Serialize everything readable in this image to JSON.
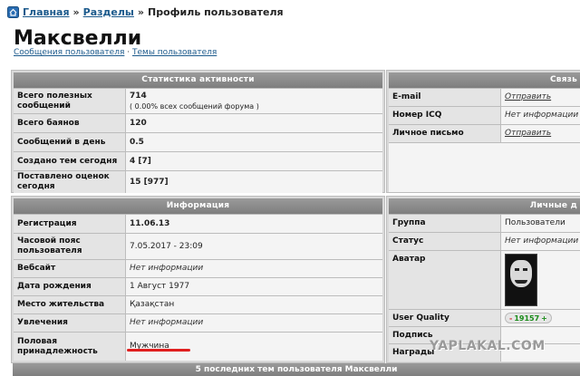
{
  "breadcrumb": {
    "home": "Главная",
    "sections": "Разделы",
    "sep": "»",
    "current": "Профиль пользователя"
  },
  "page_title": "Максвелли",
  "sublinks": {
    "messages": "Сообщения пользователя",
    "sep": "·",
    "topics": "Темы пользователя"
  },
  "stats": {
    "title": "Статистика активности",
    "rows": [
      {
        "label": "Всего полезных сообщений",
        "value": "714",
        "sub": "( 0.00% всех сообщений форума )"
      },
      {
        "label": "Всего баянов",
        "value": "120"
      },
      {
        "label": "Сообщений в день",
        "value": "0.5"
      },
      {
        "label": "Создано тем сегодня",
        "value": "4 [7]"
      },
      {
        "label": "Поставлено оценок сегодня",
        "value": "15 [977]"
      }
    ]
  },
  "contact": {
    "title": "Связь",
    "rows": [
      {
        "label": "E-mail",
        "value": "Отправить"
      },
      {
        "label": "Номер ICQ",
        "value": "Нет информации"
      },
      {
        "label": "Личное письмо",
        "value": "Отправить"
      }
    ]
  },
  "info": {
    "title": "Информация",
    "rows": [
      {
        "label": "Регистрация",
        "value": "11.06.13"
      },
      {
        "label": "Часовой пояс пользователя",
        "value": "7.05.2017 - 23:09"
      },
      {
        "label": "Вебсайт",
        "value": "Нет информации"
      },
      {
        "label": "Дата рождения",
        "value": "1 Август 1977"
      },
      {
        "label": "Место жительства",
        "value": "Қазақстан"
      },
      {
        "label": "Увлечения",
        "value": "Нет информации"
      },
      {
        "label": "Половая принадлежность",
        "value": "Мужчина"
      }
    ]
  },
  "personal": {
    "title": "Личные д",
    "rows": [
      {
        "label": "Группа",
        "value": "Пользователи"
      },
      {
        "label": "Статус",
        "value": "Нет информации"
      },
      {
        "label": "Аватар"
      },
      {
        "label": "User Quality",
        "value": "19157",
        "minus": "-",
        "plus": "+"
      },
      {
        "label": "Подпись"
      },
      {
        "label": "Награды"
      }
    ]
  },
  "bottom_bar": "5 последних тем пользователя Максвелли",
  "watermark": "YAPLAKAL.COM",
  "colors": {
    "link": "#1c5a8c",
    "header": "#8a8a8a",
    "underline_marker": "#e01f1f"
  }
}
